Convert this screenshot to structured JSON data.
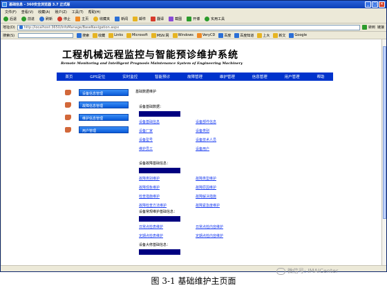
{
  "window": {
    "title": "基础信息 - 360安全浏览器 3.7 正式版"
  },
  "menu": [
    "文件(F)",
    "查看(V)",
    "收藏(A)",
    "账户(Z)",
    "工具(T)",
    "帮助(H)"
  ],
  "toolbar": {
    "back": "后退",
    "forward": "前进",
    "refresh": "刷新",
    "stop": "停止",
    "home": "主页",
    "search": "搜索",
    "favorites": "收藏夹",
    "right": [
      "新闻",
      "邮件",
      "翻译",
      "截图",
      "开博",
      "实用工具"
    ]
  },
  "address": {
    "label": "地址(D)",
    "url": "http://localhost:3650/InfoManage/BaseNavigation.aspx",
    "go": "转到",
    "links_label": "链接"
  },
  "linksbar": {
    "label": "搜索(S)",
    "search_btn": "搜索",
    "items": [
      "收藏",
      "Links",
      "Microsoft",
      "MSN 网",
      "Windows",
      "VeryCD",
      "百度",
      "百度知道",
      "上大",
      "新文",
      "Google"
    ]
  },
  "page": {
    "title_cn": "工程机械远程监控与智能预诊维护系统",
    "title_en": "Remote Monitoring and Intelligent Prognosis Maintenance System of Engineering Machinery",
    "nav": [
      "首页",
      "GPS定位",
      "实时监控",
      "智能预诊",
      "故障管理",
      "维护管理",
      "信息管理",
      "用户管理",
      "帮助"
    ],
    "sidebar": [
      "设备信息管理",
      "故障信息管理",
      "维护信息管理",
      "用户管理"
    ],
    "main_title": "基础数据维护",
    "sections": [
      {
        "title": "设备基础数据：",
        "links": [
          "设备基础信息",
          "设备部件信息",
          "设备厂家",
          "设备类别",
          "设备型号",
          "设备技术人员",
          "维护员工",
          "设备用户"
        ]
      },
      {
        "title": "设备故障基础信息：",
        "links": [
          "故障类别维护",
          "故障类型维护",
          "故障现象维护",
          "故障原因维护",
          "检查措施维护",
          "故障解决措施",
          "故障检查方法维护",
          "故障紧急度维护"
        ]
      },
      {
        "title": "设备常规维护基础信息：",
        "links": [
          "日常点检表维护",
          "日常点检内容维护",
          "定期点检表维护",
          "定期点检内容维护"
        ]
      },
      {
        "title": "设备大修基础信息：",
        "links": []
      }
    ]
  },
  "caption": "图 3-1 基础维护主页面",
  "watermark": "微信号: IMAICenter"
}
